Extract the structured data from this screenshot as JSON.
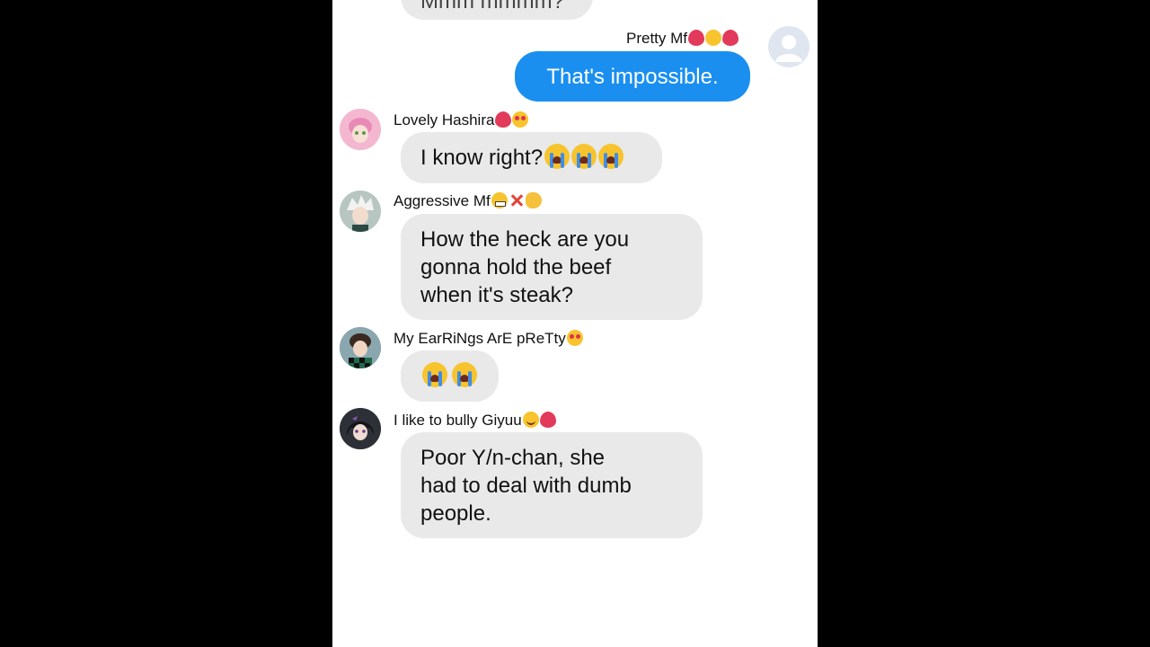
{
  "conversation": {
    "top_partial_message": "Mmm mmmm?",
    "messages": [
      {
        "sender": "Pretty Mf",
        "sender_emojis": [
          "two-hearts",
          "kissing-face",
          "mending-heart"
        ],
        "text": "That's impossible.",
        "direction": "outgoing",
        "avatar": "default-avatar"
      },
      {
        "sender": "Lovely Hashira",
        "sender_emojis": [
          "mending-heart",
          "heart-eyes"
        ],
        "text": "I know right?",
        "text_emojis": [
          "crying-face",
          "crying-face",
          "crying-face"
        ],
        "direction": "incoming",
        "avatar": "pink-green-hair-avatar"
      },
      {
        "sender": "Aggressive Mf",
        "sender_emojis": [
          "grimacing-face",
          "anger-symbol",
          "fist"
        ],
        "text_lines": [
          "How the heck are you",
          "gonna hold the beef",
          "when it's steak?"
        ],
        "direction": "incoming",
        "avatar": "white-hair-avatar"
      },
      {
        "sender": "My EarRiNgs ArE pReTty",
        "sender_emojis": [
          "heart-eyes"
        ],
        "text": "",
        "text_emojis": [
          "crying-face",
          "crying-face"
        ],
        "direction": "incoming",
        "avatar": "checkered-avatar"
      },
      {
        "sender": "I like to bully Giyuu",
        "sender_emojis": [
          "smiling-face",
          "two-hearts"
        ],
        "text_lines": [
          "Poor Y/n-chan, she",
          "had to deal with dumb",
          "people."
        ],
        "direction": "incoming",
        "avatar": "dark-hair-avatar"
      }
    ]
  },
  "colors": {
    "background": "#000000",
    "chat_background": "#ffffff",
    "incoming_bubble": "#e9e9ea",
    "outgoing_bubble": "#1a8ff0",
    "outgoing_text": "#ffffff"
  }
}
